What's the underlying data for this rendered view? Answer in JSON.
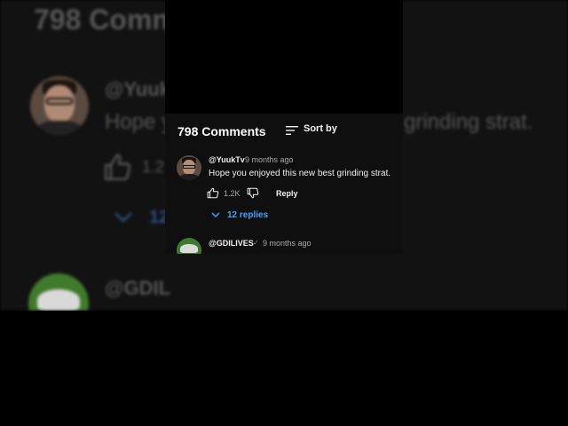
{
  "panel": {
    "title": "798 Comments",
    "sort_label": "Sort by"
  },
  "comments": [
    {
      "handle": "@YuukTv",
      "time": "9 months ago",
      "text": "Hope you enjoyed this new best grinding strat.",
      "likes": "1.2K",
      "reply_label": "Reply",
      "replies_label": "12 replies"
    },
    {
      "handle": "@GDILIVES",
      "verified_mark": "✓",
      "time": "9 months ago"
    }
  ],
  "background": {
    "title": "798 Comm",
    "handle": "@Yuuk",
    "text": "Hope y",
    "text_right": "grinding strat.",
    "likes": "1.2",
    "replies": "12",
    "handle2": "@GDIL"
  },
  "colors": {
    "panel_bg": "#0f0f0f",
    "link_blue": "#3ea6ff",
    "text_primary": "#f1f1f1",
    "text_secondary": "#aaaaaa"
  },
  "icons": [
    "sort-icon",
    "like-icon",
    "dislike-icon",
    "chevron-down-icon"
  ]
}
